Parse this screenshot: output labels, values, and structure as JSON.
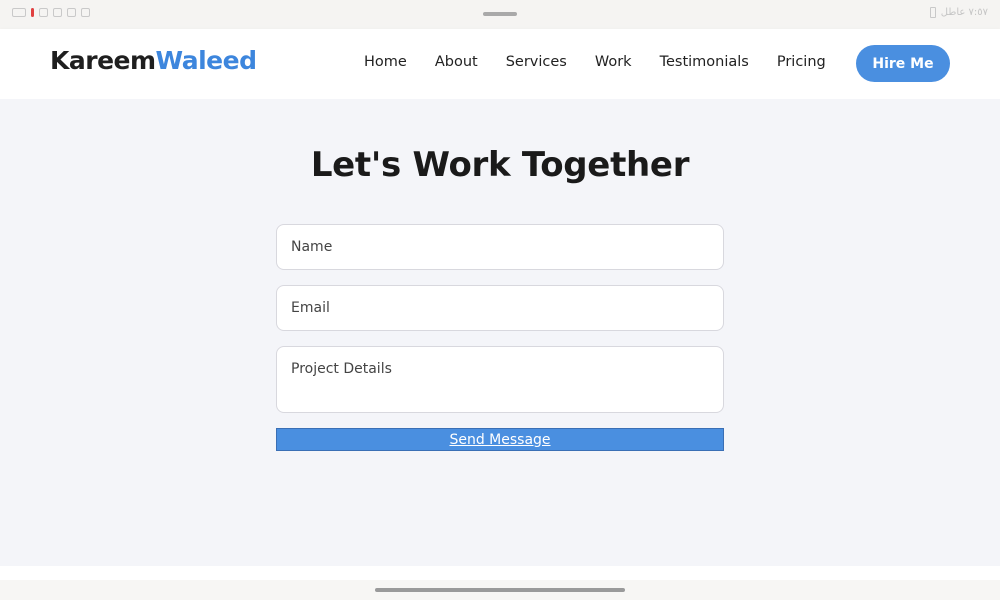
{
  "status_bar": {
    "right_text": "٧:٥٧ عاطل"
  },
  "header": {
    "logo_first": "Kareem",
    "logo_last": "Waleed",
    "nav": [
      "Home",
      "About",
      "Services",
      "Work",
      "Testimonials",
      "Pricing"
    ],
    "cta_label": "Hire Me"
  },
  "main": {
    "title": "Let's Work Together",
    "form": {
      "name_placeholder": "Name",
      "email_placeholder": "Email",
      "details_placeholder": "Project Details",
      "submit_label": "Send Message"
    }
  },
  "colors": {
    "accent": "#4a8fe0",
    "logo_accent": "#3d86dd",
    "page_bg": "#f4f5f9"
  }
}
